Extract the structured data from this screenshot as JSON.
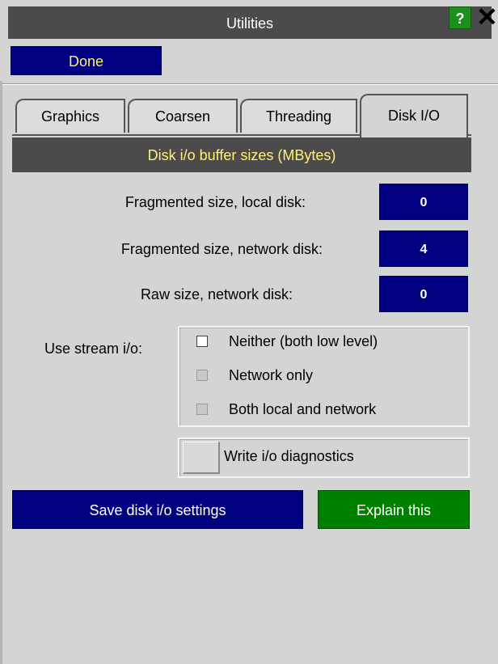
{
  "window": {
    "title": "Utilities",
    "help_label": "?",
    "close_label": "✕"
  },
  "toolbar": {
    "done_label": "Done"
  },
  "tabs": [
    {
      "label": "Graphics",
      "active": false
    },
    {
      "label": "Coarsen",
      "active": false
    },
    {
      "label": "Threading",
      "active": false
    },
    {
      "label": "Disk I/O",
      "active": true
    }
  ],
  "section": {
    "heading": "Disk i/o buffer sizes (MBytes)"
  },
  "fields": [
    {
      "label": "Fragmented size, local disk:",
      "value": "0"
    },
    {
      "label": "Fragmented size, network disk:",
      "value": "4"
    },
    {
      "label": "Raw size, network disk:",
      "value": "0"
    }
  ],
  "stream": {
    "label": "Use stream i/o:",
    "options": [
      {
        "label": "Neither (both low level)",
        "selected": true
      },
      {
        "label": "Network only",
        "selected": false
      },
      {
        "label": "Both local and network",
        "selected": false
      }
    ]
  },
  "diagnostics": {
    "label": "Write i/o diagnostics",
    "checked": false
  },
  "actions": {
    "save_label": "Save disk i/o settings",
    "explain_label": "Explain this"
  },
  "colors": {
    "accent_blue": "#000080",
    "accent_green": "#008000",
    "heading_text": "#fff17a",
    "panel_bg": "#d4d4d4"
  }
}
